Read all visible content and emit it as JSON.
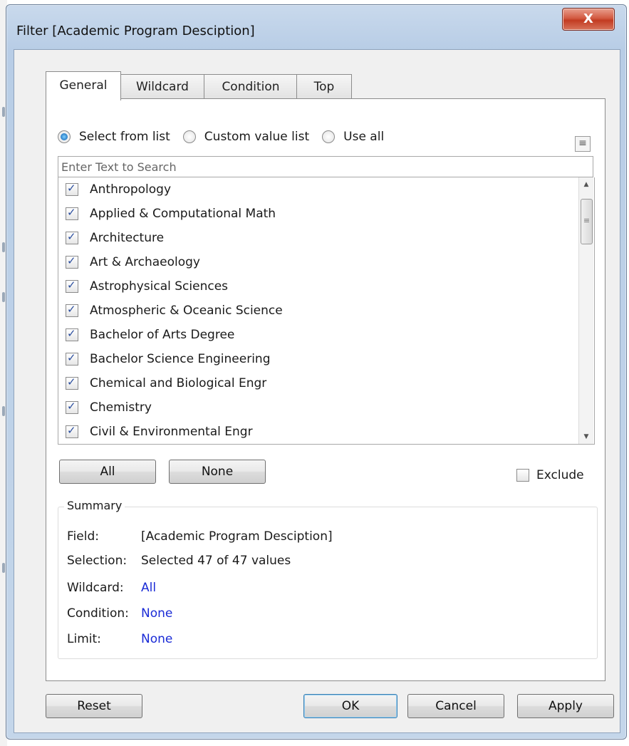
{
  "window": {
    "title": "Filter [Academic Program Desciption]",
    "close_label": "X"
  },
  "tabs": [
    {
      "label": "General",
      "active": true
    },
    {
      "label": "Wildcard",
      "active": false
    },
    {
      "label": "Condition",
      "active": false
    },
    {
      "label": "Top",
      "active": false
    }
  ],
  "mode_options": [
    {
      "label": "Select from list",
      "selected": true
    },
    {
      "label": "Custom value list",
      "selected": false
    },
    {
      "label": "Use all",
      "selected": false
    }
  ],
  "menu_icon": "list-menu-icon",
  "search": {
    "placeholder": "Enter Text to Search",
    "value": ""
  },
  "list_items": [
    {
      "label": "Anthropology",
      "checked": true
    },
    {
      "label": "Applied & Computational Math",
      "checked": true
    },
    {
      "label": "Architecture",
      "checked": true
    },
    {
      "label": "Art & Archaeology",
      "checked": true
    },
    {
      "label": "Astrophysical Sciences",
      "checked": true
    },
    {
      "label": "Atmospheric & Oceanic Science",
      "checked": true
    },
    {
      "label": "Bachelor of Arts Degree",
      "checked": true
    },
    {
      "label": "Bachelor Science Engineering",
      "checked": true
    },
    {
      "label": "Chemical and Biological Engr",
      "checked": true
    },
    {
      "label": "Chemistry",
      "checked": true
    },
    {
      "label": "Civil & Environmental Engr",
      "checked": true
    }
  ],
  "list_buttons": {
    "all_label": "All",
    "none_label": "None"
  },
  "exclude": {
    "label": "Exclude",
    "checked": false
  },
  "summary": {
    "legend": "Summary",
    "field_key": "Field:",
    "field_value": "[Academic Program Desciption]",
    "selection_key": "Selection:",
    "selection_value": "Selected 47 of 47 values",
    "wildcard_key": "Wildcard:",
    "wildcard_value": "All",
    "condition_key": "Condition:",
    "condition_value": "None",
    "limit_key": "Limit:",
    "limit_value": "None"
  },
  "footer": {
    "reset_label": "Reset",
    "ok_label": "OK",
    "cancel_label": "Cancel",
    "apply_label": "Apply"
  },
  "colors": {
    "link_blue": "#1a2bd6",
    "close_red": "#c23b22",
    "ok_border": "#3c7fb1"
  }
}
